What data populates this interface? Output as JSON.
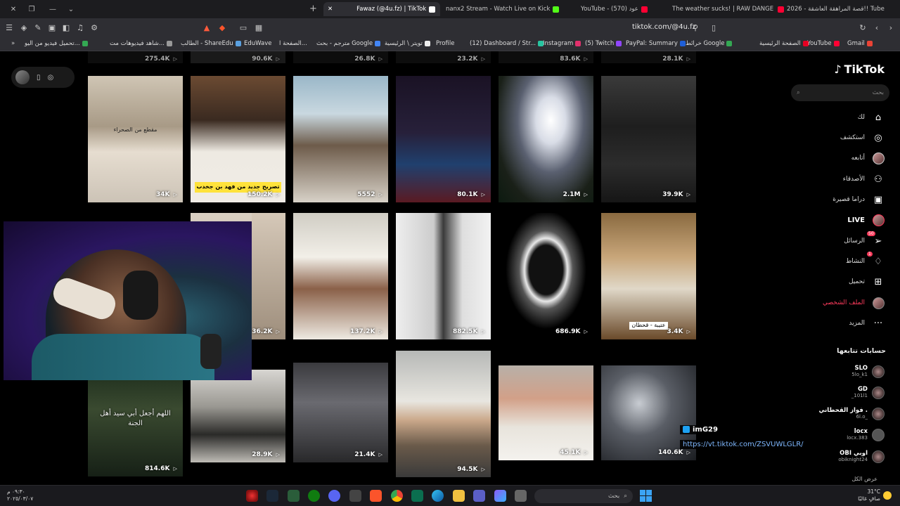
{
  "browser": {
    "tabs": [
      {
        "title": "2026 - قصة المراهقة العاشقة!! Tube",
        "favicon": "#ff0033",
        "active": false
      },
      {
        "title": "The weather sucks! | RAW DANGER (",
        "favicon": "#ff0033",
        "active": false
      },
      {
        "title": "YouTube - عود (570)",
        "favicon": "#ff0033",
        "active": false
      },
      {
        "title": "nanx2 Stream - Watch Live on Kick",
        "favicon": "#53fc18",
        "active": false
      },
      {
        "title": "Fawaz (@4u.fz) | TikTok",
        "favicon": "#ffffff",
        "active": true
      }
    ],
    "url": "tiktok.com/@4u.fz",
    "bookmarks": [
      {
        "label": "Gmail",
        "color": "#ea4335"
      },
      {
        "label": "YouTube",
        "color": "#ff0033"
      },
      {
        "label": "الصفحة الرئيسية",
        "color": "#e60023"
      },
      {
        "label": "خرائط Google",
        "color": "#34a853"
      },
      {
        "label": "PayPal: Summary",
        "color": "#1f5fd8"
      },
      {
        "label": "(5) Twitch",
        "color": "#9146ff"
      },
      {
        "label": "Instagram",
        "color": "#e1306c"
      },
      {
        "label": "(12) Dashboard / Str...",
        "color": "#27c4a0"
      },
      {
        "label": "Profile",
        "color": "#666666"
      },
      {
        "label": "تويتر \\ الرئيسية",
        "color": "#eeeeee"
      },
      {
        "label": "مترجم - بحث Google",
        "color": "#4285f4"
      },
      {
        "label": "الصفحة ا...",
        "color": "#888888"
      },
      {
        "label": "EduWave",
        "color": "#5aa0e0"
      },
      {
        "label": "الطالب - ShareEdu",
        "color": "#5aa0e0"
      },
      {
        "label": "شاهد فيديوهات مت...",
        "color": "#999999"
      },
      {
        "label": "تحميل فيديو من اليو...",
        "color": "#34a853"
      }
    ]
  },
  "top_row_counts": [
    "275.4K",
    "90.6K",
    "26.8K",
    "23.2K",
    "83.6K",
    "28.1K"
  ],
  "videos": [
    {
      "count": "34K",
      "caption": "مقطع من الصحراء",
      "caption_style": "plain"
    },
    {
      "count": "150.2K",
      "caption": "تصريح جديد من فهد بن جخدب",
      "caption_style": "yellow"
    },
    {
      "count": "5552",
      "caption": "",
      "caption_style": "plain"
    },
    {
      "count": "80.1K",
      "caption": "",
      "caption_style": "plain"
    },
    {
      "count": "2.1M",
      "caption": "",
      "caption_style": "plain"
    },
    {
      "count": "39.9K",
      "caption": "",
      "caption_style": "plain"
    },
    {
      "count": "",
      "caption": "",
      "caption_style": "plain"
    },
    {
      "count": "36.2K",
      "caption": "",
      "caption_style": "plain"
    },
    {
      "count": "137.2K",
      "caption": "",
      "caption_style": "plain"
    },
    {
      "count": "882.5K",
      "caption": "",
      "caption_style": "plain"
    },
    {
      "count": "686.9K",
      "caption": "",
      "caption_style": "plain"
    },
    {
      "count": "3.4K",
      "caption": "عتيبة - قحطان",
      "caption_style": "plain"
    },
    {
      "count": "814.6K",
      "caption": "اللهم أجعل أبي سيد أهل الجنة",
      "caption_style": "plain"
    },
    {
      "count": "28.9K",
      "caption": "",
      "caption_style": "plain"
    },
    {
      "count": "21.4K",
      "caption": "",
      "caption_style": "plain"
    },
    {
      "count": "94.5K",
      "caption": "",
      "caption_style": "plain"
    },
    {
      "count": "45.1K",
      "caption": "",
      "caption_style": "plain"
    },
    {
      "count": "140.6K",
      "caption": "",
      "caption_style": "plain"
    }
  ],
  "sidebar": {
    "brand": "TikTok",
    "search_placeholder": "بحث",
    "nav": [
      {
        "label": "لك",
        "icon": "home-icon"
      },
      {
        "label": "استكشف",
        "icon": "compass-icon"
      },
      {
        "label": "أتابعه",
        "icon": "avatar-icon"
      },
      {
        "label": "الأصدقاء",
        "icon": "friends-icon"
      },
      {
        "label": "دراما قصيرة",
        "icon": "film-icon"
      },
      {
        "label": "LIVE",
        "icon": "live-icon"
      },
      {
        "label": "الرسائل",
        "icon": "send-icon",
        "badge": "50"
      },
      {
        "label": "النشاط",
        "icon": "bell-icon",
        "badge": "1"
      },
      {
        "label": "تحميل",
        "icon": "plus-square-icon"
      },
      {
        "label": "الملف الشخصي",
        "icon": "profile-icon"
      },
      {
        "label": "المزيد",
        "icon": "more-icon"
      }
    ],
    "following_title": "حسابات تتابعها",
    "following": [
      {
        "name": "SLO",
        "handle": "5lo_k1"
      },
      {
        "name": "GD",
        "handle": "_101l1"
      },
      {
        "name": "فواز القحطاني .",
        "handle": "6l.o_"
      },
      {
        "name": "locx",
        "handle": "locx.383"
      },
      {
        "name": "OBI اوبي",
        "handle": "obiknight24"
      }
    ],
    "show_all": "عرض الكل"
  },
  "chat_overlay": {
    "user": "imG29",
    "message": "https://vt.tiktok.com/ZSVUWLGLR/"
  },
  "taskbar": {
    "time": "٠٩:٣٠ م",
    "date": "٢٠٢٥/٠٣/٠٧",
    "search_placeholder": "بحث",
    "weather_temp": "31°C",
    "weather_desc": "صافٍ غالبًا"
  }
}
